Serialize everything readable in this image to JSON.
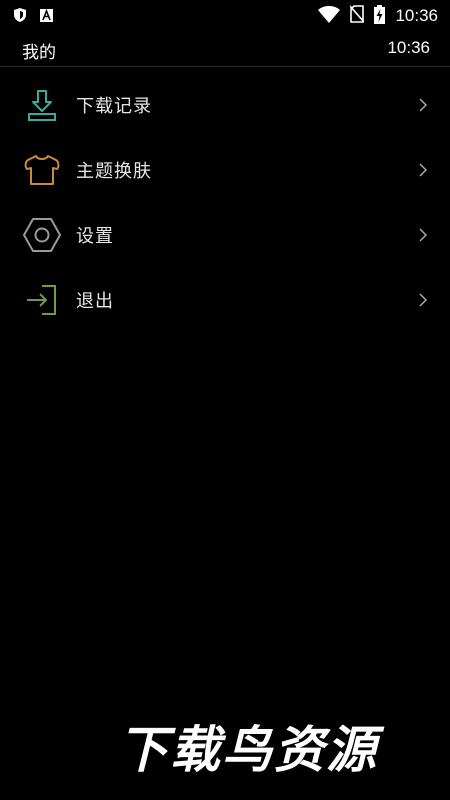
{
  "status_bar": {
    "time": "10:36",
    "left_icons": [
      "shield-icon",
      "font-a-icon"
    ],
    "right_icons": [
      "wifi-icon",
      "no-sim-icon",
      "battery-charging-icon"
    ]
  },
  "header": {
    "title": "我的",
    "time": "10:36"
  },
  "menu": {
    "items": [
      {
        "label": "下载记录",
        "icon": "download-icon",
        "color": "#3fa89c"
      },
      {
        "label": "主题换肤",
        "icon": "shirt-icon",
        "color": "#c98a3a"
      },
      {
        "label": "设置",
        "icon": "hex-nut-icon",
        "color": "#9a9a9a"
      },
      {
        "label": "退出",
        "icon": "exit-icon",
        "color": "#6f9a4a"
      }
    ]
  },
  "watermark": "下载鸟资源",
  "colors": {
    "background": "#000000",
    "text": "#e6e6e6",
    "divider": "#2a2a2a"
  }
}
